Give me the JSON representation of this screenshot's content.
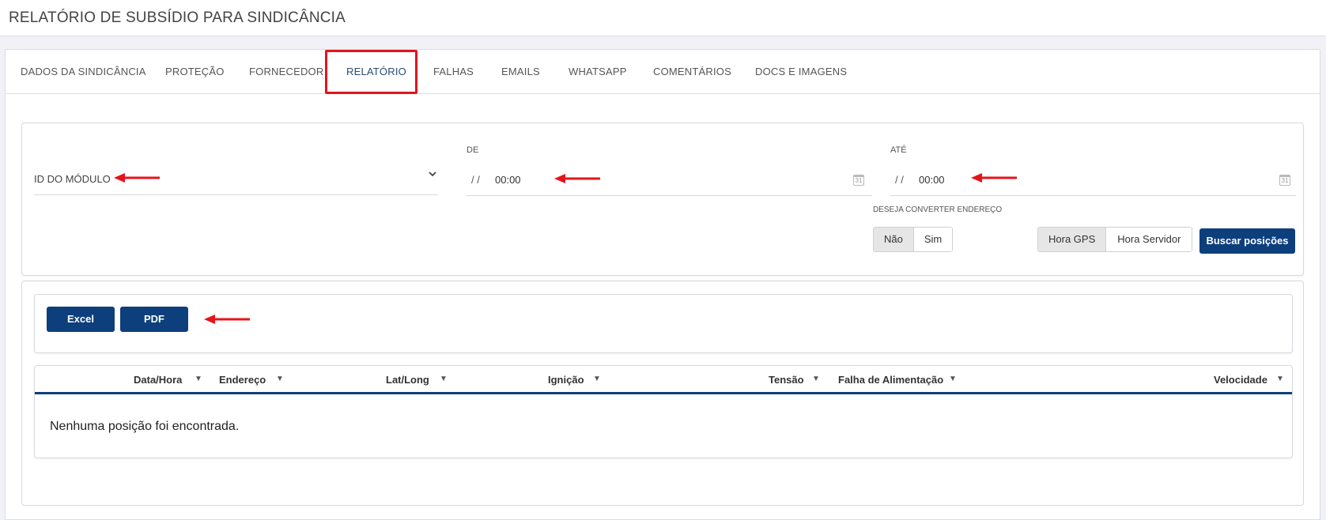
{
  "header": {
    "title": "RELATÓRIO DE SUBSÍDIO PARA SINDICÂNCIA"
  },
  "tabs": [
    {
      "label": "DADOS DA SINDICÂNCIA"
    },
    {
      "label": "PROTEÇÃO"
    },
    {
      "label": "FORNECEDOR"
    },
    {
      "label": "RELATÓRIO",
      "active": true
    },
    {
      "label": "FALHAS"
    },
    {
      "label": "EMAILS"
    },
    {
      "label": "WHATSAPP"
    },
    {
      "label": "COMENTÁRIOS"
    },
    {
      "label": "DOCS E IMAGENS"
    }
  ],
  "filters": {
    "module_select": {
      "placeholder": "ID DO MÓDULO"
    },
    "date_from": {
      "label": "DE",
      "date": "/ /",
      "time": "00:00"
    },
    "date_to": {
      "label": "ATÉ",
      "date": "/ /",
      "time": "00:00"
    },
    "convert_address": {
      "label": "DESEJA CONVERTER ENDEREÇO",
      "options": [
        "Não",
        "Sim"
      ],
      "selected": "Não"
    },
    "time_source": {
      "options": [
        "Hora GPS",
        "Hora Servidor"
      ],
      "selected": "Hora GPS"
    },
    "search_button": "Buscar posições"
  },
  "export": {
    "excel": "Excel",
    "pdf": "PDF"
  },
  "table": {
    "columns": [
      "Data/Hora",
      "Endereço",
      "Lat/Long",
      "Ignição",
      "Tensão",
      "Falha de Alimentação",
      "Velocidade"
    ],
    "empty_message": "Nenhuma posição foi encontrada."
  },
  "colors": {
    "primary": "#0d3f7d",
    "highlight": "#e5141b"
  },
  "icons": [
    "chevron-down-icon",
    "calendar-icon",
    "sort-caret-icon",
    "annotation-arrow-icon"
  ]
}
